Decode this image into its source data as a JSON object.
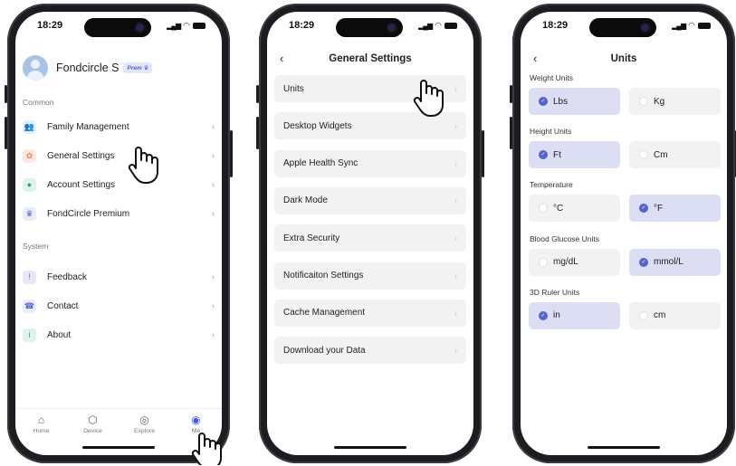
{
  "status": {
    "time": "18:29"
  },
  "phone1": {
    "profile": {
      "name": "Fondcircle S",
      "badge": "Prem ♛"
    },
    "sections": {
      "common": "Common",
      "system": "System"
    },
    "common_items": [
      {
        "label": "Family Management",
        "icon": "family-icon",
        "color": "#e9ecfb"
      },
      {
        "label": "General Settings",
        "icon": "gear-icon",
        "color": "#fde9e0"
      },
      {
        "label": "Account Settings",
        "icon": "account-icon",
        "color": "#dff3ec"
      },
      {
        "label": "FondCircle Premium",
        "icon": "crown-icon",
        "color": "#e9ecfb"
      }
    ],
    "system_items": [
      {
        "label": "Feedback",
        "icon": "feedback-icon",
        "color": "#ebe5f7"
      },
      {
        "label": "Contact",
        "icon": "phone-icon",
        "color": "#e9ecfb"
      },
      {
        "label": "About",
        "icon": "info-icon",
        "color": "#dff3ec"
      }
    ],
    "tabs": [
      {
        "label": "Home",
        "icon": "home-icon"
      },
      {
        "label": "Device",
        "icon": "device-icon"
      },
      {
        "label": "Explore",
        "icon": "compass-icon"
      },
      {
        "label": "Me",
        "icon": "me-icon",
        "active": true
      }
    ]
  },
  "phone2": {
    "title": "General Settings",
    "items": [
      "Units",
      "Desktop Widgets",
      "Apple Health Sync",
      "Dark Mode",
      "Extra Security",
      "Notificaiton Settings",
      "Cache Management",
      "Download your Data"
    ]
  },
  "phone3": {
    "title": "Units",
    "groups": [
      {
        "label": "Weight Units",
        "options": [
          {
            "text": "Lbs",
            "selected": true
          },
          {
            "text": "Kg",
            "selected": false
          }
        ]
      },
      {
        "label": "Height Units",
        "options": [
          {
            "text": "Ft",
            "selected": true
          },
          {
            "text": "Cm",
            "selected": false
          }
        ]
      },
      {
        "label": "Temperature",
        "options": [
          {
            "text": "°C",
            "selected": false
          },
          {
            "text": "°F",
            "selected": true
          }
        ]
      },
      {
        "label": "Blood Glucose Units",
        "options": [
          {
            "text": "mg/dL",
            "selected": false
          },
          {
            "text": "mmol/L",
            "selected": true
          }
        ]
      },
      {
        "label": "3D Ruler Units",
        "options": [
          {
            "text": "in",
            "selected": true
          },
          {
            "text": "cm",
            "selected": false
          }
        ]
      }
    ]
  },
  "colors": {
    "accent": "#5663c9",
    "selected_bg": "#dcdef4",
    "row_bg": "#f2f2f2"
  }
}
